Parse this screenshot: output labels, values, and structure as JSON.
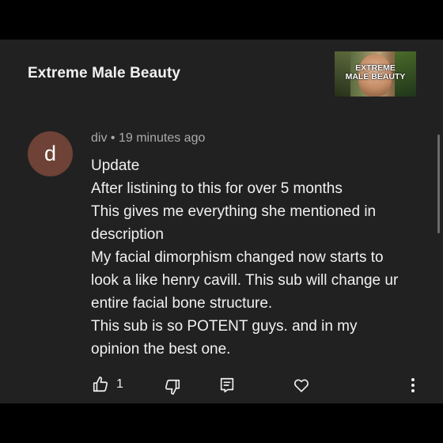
{
  "header": {
    "title": "Extreme Male Beauty",
    "thumbnail": {
      "line1": "EXTREME",
      "line2": "MALE BEAUTY"
    }
  },
  "comment": {
    "avatar_letter": "d",
    "avatar_color": "#6e4236",
    "author": "div",
    "separator": "•",
    "time": "19 minutes ago",
    "lines": [
      "Update",
      "After listining to this for over 5 months",
      "This gives me everything she mentioned in",
      "description",
      "My facial dimorphism changed now starts to",
      "look a like henry cavill. This sub will change ur",
      "entire facial bone structure.",
      "This sub is so POTENT guys. and in my",
      "opinion the best one."
    ],
    "like_count": "1"
  },
  "icons": {
    "like": "thumbs-up-icon",
    "dislike": "thumbs-down-icon",
    "reply": "reply-icon",
    "heart": "heart-icon",
    "more": "more-vertical-icon"
  },
  "colors": {
    "background": "#000000",
    "panel": "#212121",
    "text": "#f1f1f1",
    "meta": "#aaaaaa"
  }
}
